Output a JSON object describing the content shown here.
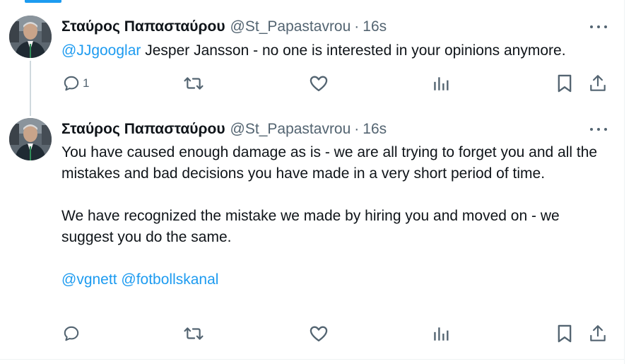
{
  "tweets": [
    {
      "author": {
        "name": "Σταύρος Παπασταύρου",
        "handle": "@St_Papastavrou",
        "separator": "·",
        "time": "16s"
      },
      "mention": "@JJgooglar",
      "text": " Jesper Jansson - no one is interested in your opinions anymore.",
      "actions": {
        "reply_count": "1"
      },
      "icons": [
        "reply-icon",
        "retweet-icon",
        "like-icon",
        "views-icon",
        "bookmark-icon",
        "share-icon",
        "more-icon"
      ]
    },
    {
      "author": {
        "name": "Σταύρος Παπασταύρου",
        "handle": "@St_Papastavrou",
        "separator": "·",
        "time": "16s"
      },
      "paragraph1": "You have caused enough damage as is - we are all trying to forget you and all the mistakes and bad decisions you have made in a very short period of time.",
      "paragraph2": "We have recognized the mistake we made by hiring you and moved on - we suggest you do the same.",
      "mentions": [
        "@vgnett",
        "@fotbollskanal"
      ],
      "icons": [
        "reply-icon",
        "retweet-icon",
        "like-icon",
        "views-icon",
        "bookmark-icon",
        "share-icon",
        "more-icon"
      ]
    }
  ],
  "colors": {
    "link": "#1d9bf0",
    "text": "#0f1419",
    "secondary": "#536471",
    "thread_line": "#cfd9de"
  }
}
